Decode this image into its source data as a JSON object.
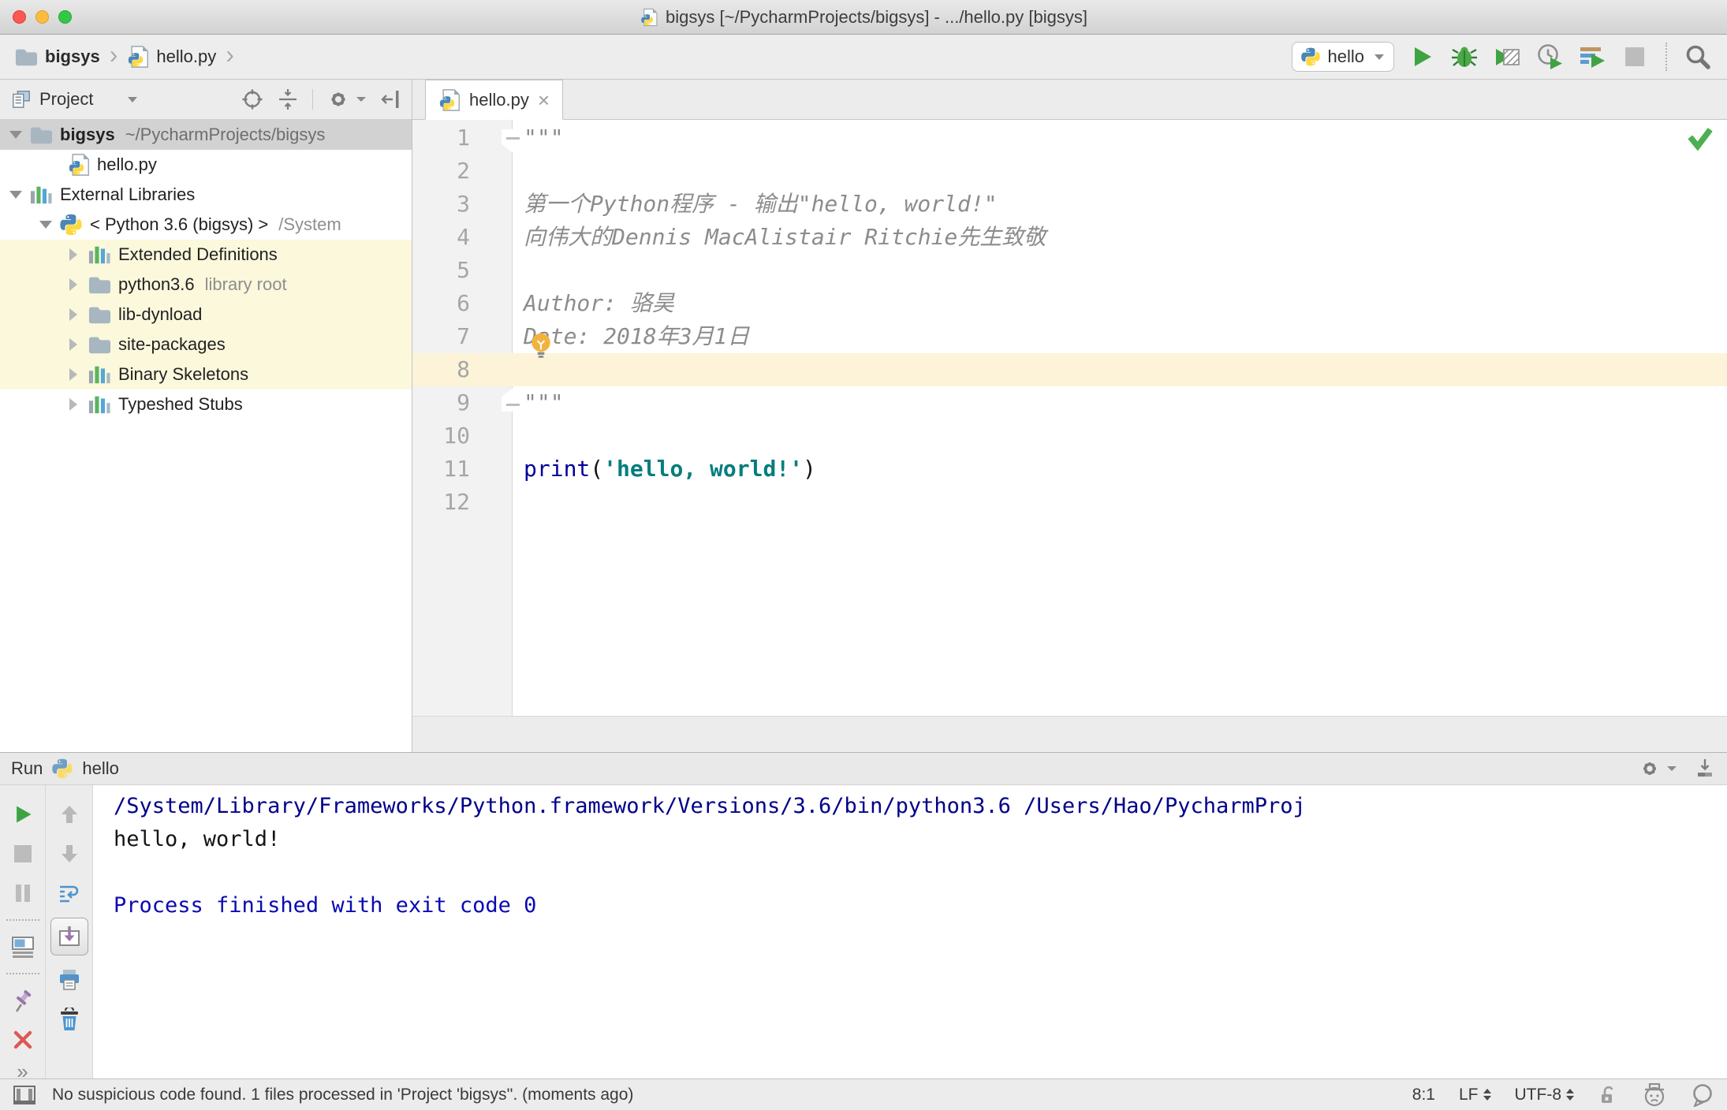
{
  "window": {
    "title": "bigsys [~/PycharmProjects/bigsys] - .../hello.py [bigsys]"
  },
  "icons": {
    "breadcrumb_separator": "›",
    "tab_close": "×",
    "more": "»"
  },
  "navbar": {
    "breadcrumbs": {
      "project": "bigsys",
      "file": "hello.py"
    },
    "run_config": "hello"
  },
  "project_panel": {
    "title": "Project",
    "tree": [
      {
        "label": "bigsys",
        "suffix": "~/PycharmProjects/bigsys"
      },
      {
        "label": "hello.py",
        "suffix": ""
      },
      {
        "label": "External Libraries",
        "suffix": ""
      },
      {
        "label": "< Python 3.6 (bigsys) >",
        "suffix": "/System"
      },
      {
        "label": "Extended Definitions",
        "suffix": ""
      },
      {
        "label": "python3.6",
        "suffix": "library root"
      },
      {
        "label": "lib-dynload",
        "suffix": ""
      },
      {
        "label": "site-packages",
        "suffix": ""
      },
      {
        "label": "Binary Skeletons",
        "suffix": ""
      },
      {
        "label": "Typeshed Stubs",
        "suffix": ""
      }
    ]
  },
  "editor": {
    "tab": "hello.py",
    "lines": [
      {
        "num": "1",
        "text": "\"\"\""
      },
      {
        "num": "2",
        "text": ""
      },
      {
        "num": "3",
        "text": "第一个Python程序 - 输出\"hello, world!\""
      },
      {
        "num": "4",
        "text": "向伟大的Dennis MacAlistair Ritchie先生致敬"
      },
      {
        "num": "5",
        "text": ""
      },
      {
        "num": "6",
        "text": "Author: 骆昊"
      },
      {
        "num": "7",
        "text": "Date: 2018年3月1日"
      },
      {
        "num": "8",
        "text": ""
      },
      {
        "num": "9",
        "text": "\"\"\""
      },
      {
        "num": "10",
        "text": ""
      },
      {
        "num": "11",
        "kw": "print",
        "paren_open": "(",
        "str": "'hello, world!'",
        "paren_close": ")"
      },
      {
        "num": "12",
        "text": ""
      }
    ]
  },
  "run_panel": {
    "title": "Run",
    "config": "hello",
    "console": {
      "cmd": "/System/Library/Frameworks/Python.framework/Versions/3.6/bin/python3.6 /Users/Hao/PycharmProj",
      "output": "hello, world!",
      "exit": "Process finished with exit code 0"
    }
  },
  "status_bar": {
    "message": "No suspicious code found. 1 files processed in 'Project 'bigsys''. (moments ago)",
    "caret": "8:1",
    "line_ending": "LF",
    "encoding": "UTF-8"
  }
}
